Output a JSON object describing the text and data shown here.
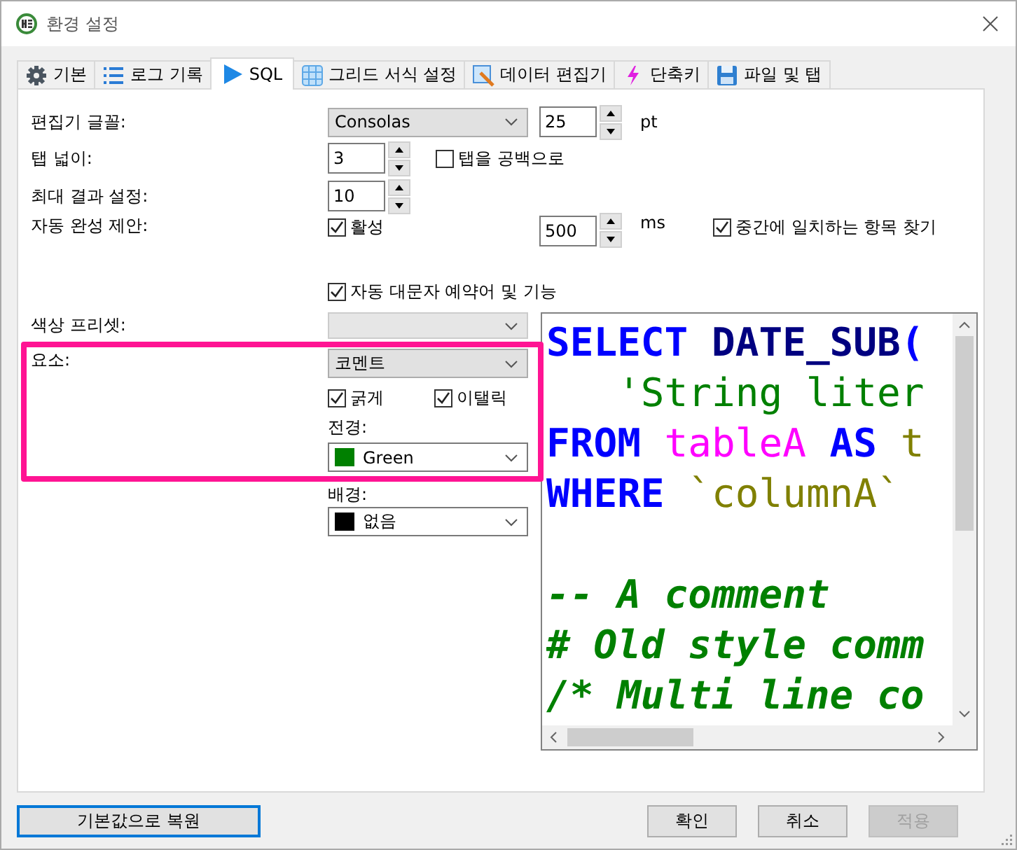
{
  "window": {
    "title": "환경 설정"
  },
  "tabs": [
    {
      "label": "기본",
      "selected": false
    },
    {
      "label": "로그 기록",
      "selected": false
    },
    {
      "label": "SQL",
      "selected": true
    },
    {
      "label": "그리드 서식 설정",
      "selected": false
    },
    {
      "label": "데이터 편집기",
      "selected": false
    },
    {
      "label": "단축키",
      "selected": false
    },
    {
      "label": "파일 및 탭",
      "selected": false
    }
  ],
  "editor_font": {
    "label": "편집기 글꼴:",
    "font": "Consolas",
    "size": "25",
    "unit": "pt"
  },
  "tab_width": {
    "label": "탭 넓이:",
    "value": "3",
    "use_spaces": {
      "label": "탭을 공백으로",
      "checked": false
    }
  },
  "max_results": {
    "label": "최대 결과 설정:",
    "value": "10"
  },
  "autocomplete": {
    "label": "자동 완성 제안:",
    "enabled": {
      "label": "활성",
      "checked": true
    },
    "delay": "500",
    "unit": "ms",
    "match_middle": {
      "label": "중간에 일치하는 항목 찾기",
      "checked": true
    }
  },
  "auto_uppercase": {
    "label": "자동 대문자 예약어 및 기능",
    "checked": true
  },
  "color_preset": {
    "label": "색상 프리셋:"
  },
  "element": {
    "label": "요소:",
    "value": "코멘트",
    "bold": {
      "label": "굵게",
      "checked": true
    },
    "italic": {
      "label": "이탤릭",
      "checked": true
    },
    "foreground": {
      "label": "전경:",
      "value": "Green",
      "color": "#008000"
    },
    "background": {
      "label": "배경:",
      "value": "없음",
      "color": "#000000"
    }
  },
  "preview": {
    "query_lines": [
      [
        {
          "text": "SELECT",
          "kind": "keyword"
        },
        {
          "text": " DATE_SUB",
          "kind": "function"
        },
        {
          "text": "(",
          "kind": "keyword"
        }
      ],
      [
        {
          "text": "   'String liter",
          "kind": "string"
        }
      ],
      [
        {
          "text": "FROM",
          "kind": "keyword"
        },
        {
          "text": " tableA",
          "kind": "table"
        },
        {
          "text": " AS",
          "kind": "keyword"
        },
        {
          "text": " t",
          "kind": "alias"
        }
      ],
      [
        {
          "text": "WHERE",
          "kind": "keyword"
        },
        {
          "text": " `columnA`",
          "kind": "alias"
        }
      ]
    ],
    "comment_lines": [
      "-- A comment",
      "# Old style comm",
      "/* Multi line co"
    ]
  },
  "buttons": [
    {
      "label": "기본값으로 복원",
      "focused": true,
      "disabled": false
    },
    {
      "label": "확인",
      "focused": false,
      "disabled": false
    },
    {
      "label": "취소",
      "focused": false,
      "disabled": false
    },
    {
      "label": "적용",
      "focused": false,
      "disabled": true
    }
  ]
}
